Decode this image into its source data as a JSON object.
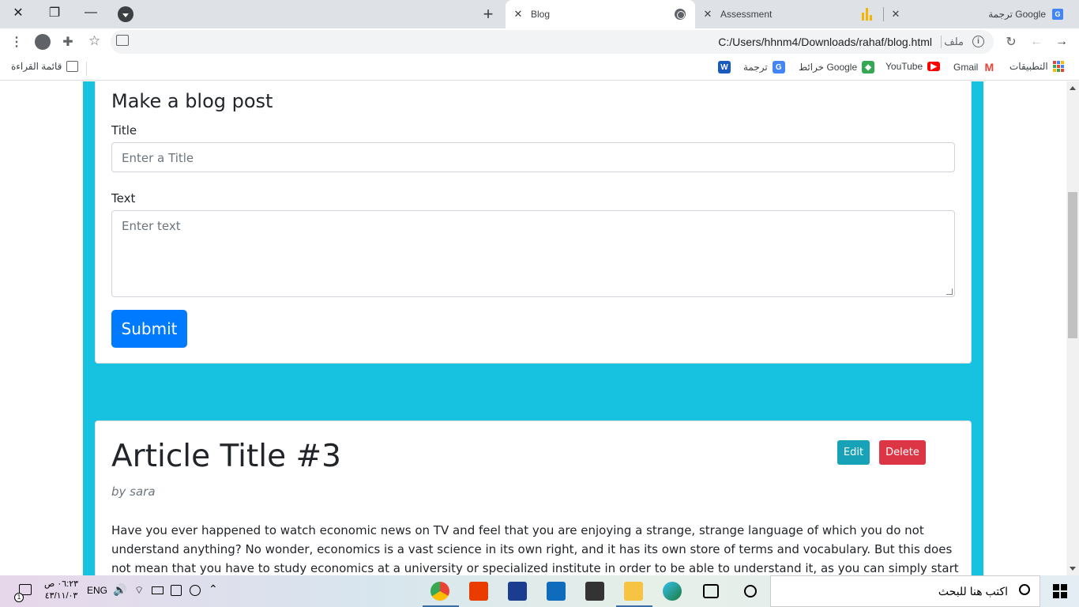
{
  "browser": {
    "tabs": [
      {
        "title": "Blog",
        "active": true
      },
      {
        "title": "Assessment",
        "active": false
      },
      {
        "title": "ترجمة Google",
        "active": false
      }
    ],
    "url": "C:/Users/hhnm4/Downloads/rahaf/blog.html",
    "url_scheme_label": "ملف",
    "bookmarks": [
      {
        "label": "التطبيقات",
        "icon": "apps-icon"
      },
      {
        "label": "Gmail",
        "icon": "gmail-icon"
      },
      {
        "label": "YouTube",
        "icon": "youtube-icon"
      },
      {
        "label": "خرائط Google",
        "icon": "maps-icon"
      },
      {
        "label": "ترجمة",
        "icon": "translate-icon"
      },
      {
        "label": "",
        "icon": "word-icon"
      }
    ],
    "reading_list": "قائمة القراءة"
  },
  "form": {
    "heading": "Make a blog post",
    "title_label": "Title",
    "title_placeholder": "Enter a Title",
    "text_label": "Text",
    "text_placeholder": "Enter text",
    "submit_label": "Submit"
  },
  "article": {
    "title": "Article Title #3",
    "author": "by sara",
    "edit_label": "Edit",
    "delete_label": "Delete",
    "body": "Have you ever happened to watch economic news on TV and feel that you are enjoying a strange, strange language of which you do not understand anything? No wonder, economics is a vast science in its own right, and it has its own store of terms and vocabulary. But this does not mean that you have to study economics at a university or specialized institute in order to be able to understand it, as you can simply start by getting to know the most"
  },
  "taskbar": {
    "time": "٠٦:٢٣ ص",
    "date": "٤٣/١١/٠٣",
    "lang": "ENG",
    "search_placeholder": "اكتب هنا للبحث",
    "notification_count": "1"
  },
  "colors": {
    "page_background": "#17c1e0",
    "submit": "#007bff",
    "edit": "#17a2b8",
    "delete": "#dc3545"
  }
}
